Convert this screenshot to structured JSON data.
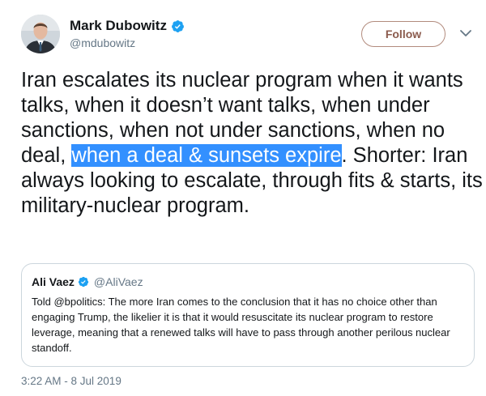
{
  "author": {
    "display_name": "Mark Dubowitz",
    "handle": "@mdubowitz",
    "verified": true,
    "avatar_icon": "profile-photo"
  },
  "follow_button": {
    "label": "Follow"
  },
  "menu": {
    "icon": "chevron-down-icon"
  },
  "tweet": {
    "text_before": "Iran escalates its nuclear program when it wants talks, when it doesn’t want talks, when under sanctions, when not under sanctions, when no deal, ",
    "text_highlighted": "when a deal & sunsets expire",
    "text_after": ". Shorter: Iran always looking to escalate, through fits & starts, its military-nuclear program."
  },
  "quoted_tweet": {
    "display_name": "Ali Vaez",
    "handle": "@AliVaez",
    "verified": true,
    "text": "Told @bpolitics: The more Iran comes to the conclusion that it has no choice other than engaging Trump, the likelier it is that it would resuscitate its nuclear program to restore leverage, meaning that a renewed talks will have to pass through another perilous nuclear standoff."
  },
  "timestamp": "3:22 AM - 8 Jul 2019",
  "colors": {
    "verified": "#1da1f2",
    "follow_border": "#b28b7d",
    "follow_text": "#8b5b4d",
    "selection_highlight": "#3390ff",
    "secondary_text": "#657786"
  }
}
